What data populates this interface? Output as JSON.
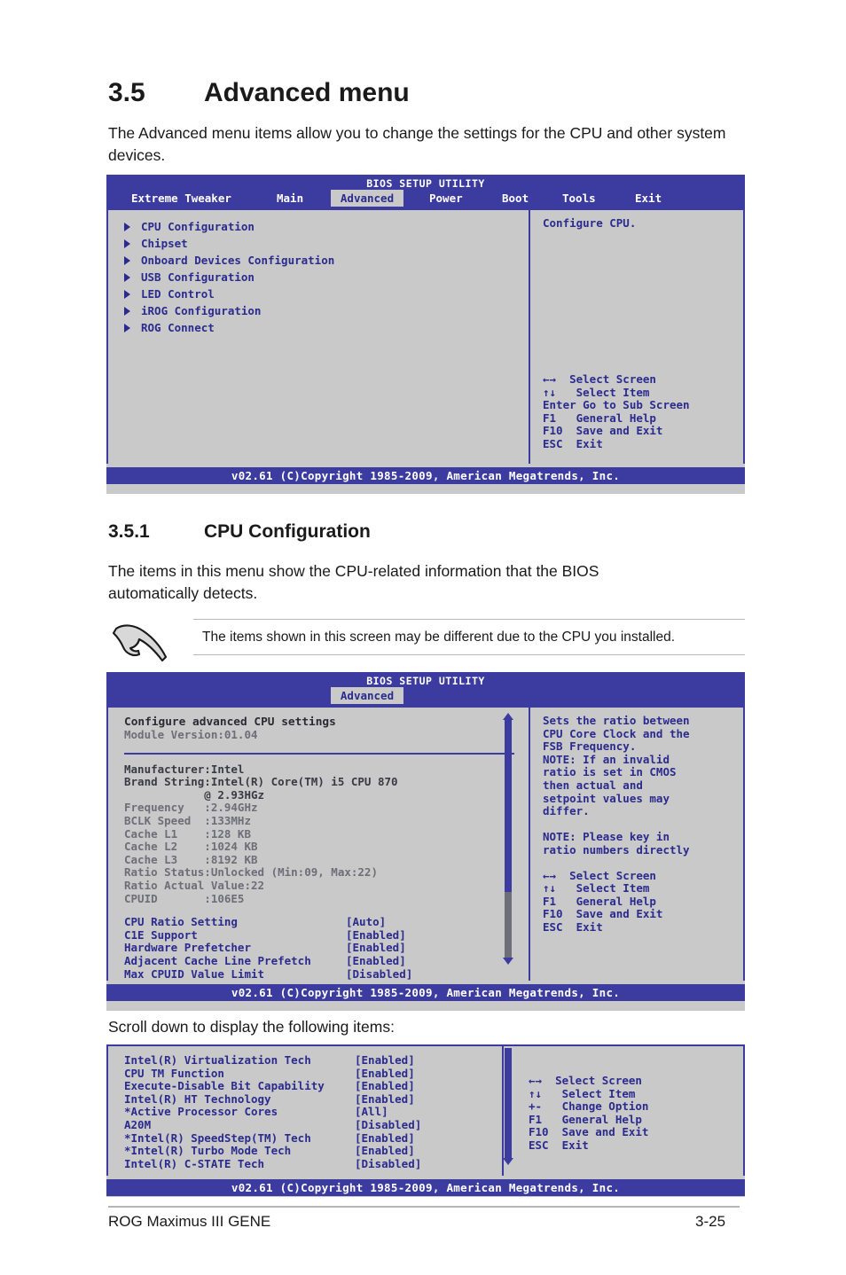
{
  "document": {
    "section": {
      "number": "3.5",
      "title": "Advanced menu"
    },
    "intro": "The Advanced menu items allow you to change the settings for the CPU and other system devices.",
    "subsection": {
      "number": "3.5.1",
      "title": "CPU Configuration"
    },
    "subsection_intro": "The items in this menu show the CPU-related information that the BIOS automatically detects.",
    "note": "The items shown in this screen may be different due to the CPU you installed.",
    "scroll_caption": "Scroll down to display the following items:",
    "footer_left": "ROG Maximus III GENE",
    "footer_right": "3-25"
  },
  "bios_common": {
    "title": "BIOS SETUP UTILITY",
    "copyright": "v02.61 (C)Copyright 1985-2009, American Megatrends, Inc.",
    "colors": {
      "blue": "#3b3ba0",
      "text_blue": "#2b2b8f",
      "bg_gray": "#c9c9c9",
      "gray_text": "#6e6e78"
    }
  },
  "screen1": {
    "tabs": [
      {
        "label": "Extreme Tweaker",
        "active": false
      },
      {
        "label": "Main",
        "active": false
      },
      {
        "label": "Advanced",
        "active": true
      },
      {
        "label": "Power",
        "active": false
      },
      {
        "label": "Boot",
        "active": false
      },
      {
        "label": "Tools",
        "active": false
      },
      {
        "label": "Exit",
        "active": false
      }
    ],
    "menu_items": [
      "CPU Configuration",
      "Chipset",
      "Onboard Devices Configuration",
      "USB Configuration",
      "LED Control",
      "iROG Configuration",
      "ROG Connect"
    ],
    "help": "Configure CPU.",
    "legend": [
      "←→  Select Screen",
      "↑↓   Select Item",
      "Enter Go to Sub Screen",
      "F1   General Help",
      "F10  Save and Exit",
      "ESC  Exit"
    ]
  },
  "screen2": {
    "tab": "Advanced",
    "heading": "Configure advanced CPU settings",
    "module_version": "Module Version:01.04",
    "info_lines": [
      "Manufacturer:Intel",
      "Brand String:Intel(R) Core(TM) i5 CPU 870",
      "            @ 2.93HGz",
      "Frequency   :2.94GHz",
      "BCLK Speed  :133MHz",
      "Cache L1    :128 KB",
      "Cache L2    :1024 KB",
      "Cache L3    :8192 KB",
      "Ratio Status:Unlocked (Min:09, Max:22)",
      "Ratio Actual Value:22",
      "CPUID       :106E5"
    ],
    "options": [
      {
        "label": "CPU Ratio Setting",
        "value": "[Auto]"
      },
      {
        "label": "C1E Support",
        "value": "[Enabled]"
      },
      {
        "label": "Hardware Prefetcher",
        "value": "[Enabled]"
      },
      {
        "label": "Adjacent Cache Line Prefetch",
        "value": "[Enabled]"
      },
      {
        "label": "Max CPUID Value Limit",
        "value": "[Disabled]"
      }
    ],
    "help": [
      "Sets the ratio between",
      "CPU Core Clock and the",
      "FSB Frequency.",
      "NOTE: If an invalid",
      "ratio is set in CMOS",
      "then actual and",
      "setpoint values may",
      "differ.",
      "",
      "NOTE: Please key in",
      "ratio numbers directly"
    ],
    "legend": [
      "←→  Select Screen",
      "↑↓   Select Item",
      "F1   General Help",
      "F10  Save and Exit",
      "ESC  Exit"
    ]
  },
  "screen3": {
    "options": [
      {
        "label": "Intel(R) Virtualization Tech",
        "value": "[Enabled]"
      },
      {
        "label": "CPU TM Function",
        "value": "[Enabled]"
      },
      {
        "label": "Execute-Disable Bit Capability",
        "value": "[Enabled]"
      },
      {
        "label": "Intel(R) HT Technology",
        "value": "[Enabled]"
      },
      {
        "label": "*Active Processor Cores",
        "value": "[All]"
      },
      {
        "label": "A20M",
        "value": "[Disabled]"
      },
      {
        "label": "*Intel(R) SpeedStep(TM) Tech",
        "value": "[Enabled]"
      },
      {
        "label": "*Intel(R) Turbo Mode Tech",
        "value": "[Enabled]"
      },
      {
        "label": "Intel(R) C-STATE Tech",
        "value": "[Disabled]"
      }
    ],
    "legend": [
      "←→  Select Screen",
      "↑↓   Select Item",
      "+-   Change Option",
      "F1   General Help",
      "F10  Save and Exit",
      "ESC  Exit"
    ]
  }
}
